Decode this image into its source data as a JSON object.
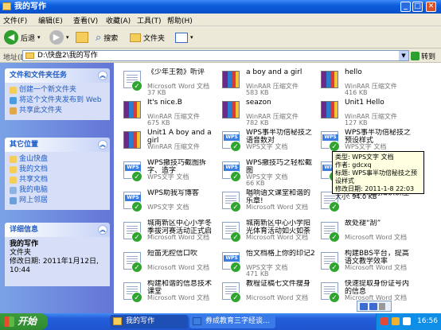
{
  "window": {
    "title": "我的写作"
  },
  "menu": [
    "文件(F)",
    "编辑(E)",
    "查看(V)",
    "收藏(A)",
    "工具(T)",
    "帮助(H)"
  ],
  "toolbar": {
    "back": "后退",
    "search": "搜索",
    "folders": "文件夹"
  },
  "address": {
    "label": "地址(D)",
    "path": "D:\\快盘2\\我的写作",
    "go": "转到"
  },
  "sidebar": {
    "tasks": {
      "title": "文件和文件夹任务",
      "items": [
        "创建一个新文件夹",
        "将这个文件夹发布到 Web",
        "共享此文件夹"
      ]
    },
    "places": {
      "title": "其它位置",
      "items": [
        "金山快盘",
        "我的文档",
        "共享文档",
        "我的电脑",
        "网上邻居"
      ]
    },
    "details": {
      "title": "详细信息",
      "name": "我的写作",
      "type": "文件夹",
      "modified": "修改日期: 2011年1月12日, 10:44"
    }
  },
  "files": [
    {
      "name": "《少年王勃》听评",
      "type": "Microsoft Word 文档",
      "size": "37 KB",
      "icon": "word"
    },
    {
      "name": "a boy and a girl",
      "type": "WinRAR 压缩文件",
      "size": "583 KB",
      "icon": "rar"
    },
    {
      "name": "hello",
      "type": "WinRAR 压缩文件",
      "size": "416 KB",
      "icon": "rar"
    },
    {
      "name": "It's nice.B",
      "type": "WinRAR 压缩文件",
      "size": "675 KB",
      "icon": "rar"
    },
    {
      "name": "seazon",
      "type": "WinRAR 压缩文件",
      "size": "782 KB",
      "icon": "rar"
    },
    {
      "name": "Unit1 Hello",
      "type": "WinRAR 压缩文件",
      "size": "127 KB",
      "icon": "rar"
    },
    {
      "name": "Unit1 A boy and a girl",
      "type": "WinRAR 压缩文件",
      "size": "",
      "icon": "rar"
    },
    {
      "name": "WPS事半功倍秘技之语音数对",
      "type": "WPS文字 文档",
      "size": "",
      "icon": "wps"
    },
    {
      "name": "WPS事半功倍秘技之预设样式",
      "type": "WPS文字 文档",
      "size": "",
      "icon": "wps"
    },
    {
      "name": "WPS撤技巧截图拆字、造字",
      "type": "WPS文字 文档",
      "size": "",
      "icon": "wps"
    },
    {
      "name": "WPS撤技巧之轻松截图",
      "type": "WPS文字 文档",
      "size": "66 KB",
      "icon": "wps"
    },
    {
      "name": "",
      "type": "",
      "size": "",
      "icon": "wps"
    },
    {
      "name": "WPS助我写博客",
      "type": "WPS文字 文档",
      "size": "",
      "icon": "wps"
    },
    {
      "name": "唱响语文课堂和谐的乐章!",
      "type": "Microsoft Word 文档",
      "size": "",
      "icon": "word"
    },
    {
      "name": "学習行消防知识讲座",
      "type": "",
      "size": "",
      "icon": "word"
    },
    {
      "name": "城南新区中心小学冬季拔河赛活动正式启动",
      "type": "Microsoft Word 文档",
      "size": "",
      "icon": "word"
    },
    {
      "name": "城南新区中心小学阳光体育活动如火如荼",
      "type": "Microsoft Word 文档",
      "size": "",
      "icon": "word"
    },
    {
      "name": "故处褪“刮”",
      "type": "Microsoft Word 文档",
      "size": "",
      "icon": "word"
    },
    {
      "name": "短笛无腔信口吹",
      "type": "Microsoft Word 文档",
      "size": "",
      "icon": "word"
    },
    {
      "name": "怡文档格上你的印记2",
      "type": "WPS文字 文档",
      "size": "471 KB",
      "icon": "wps"
    },
    {
      "name": "构建BBS平台，提高语文教学效率",
      "type": "Microsoft Word 文档",
      "size": "",
      "icon": "word"
    },
    {
      "name": "构建和谐的信息技术课堂",
      "type": "Microsoft Word 文档",
      "size": "",
      "icon": "word"
    },
    {
      "name": "教程证稿七文件瘦身",
      "type": "Microsoft Word 文档",
      "size": "",
      "icon": "word"
    },
    {
      "name": "快速提取身份证号内的信息",
      "type": "Microsoft Word 文档",
      "size": "",
      "icon": "word"
    }
  ],
  "tooltip": {
    "lines": [
      "类型: WPS文字 文档",
      "作者: gdcxq",
      "标题: WPS事半功倍秘技之预设样式",
      "修改日期: 2011-1-8 22:03",
      "大小: 94.0 KB"
    ]
  },
  "taskbar": {
    "start": "开始",
    "tasks": [
      "我的写作",
      "券成教育三字经谈..."
    ],
    "time": "16:56"
  }
}
